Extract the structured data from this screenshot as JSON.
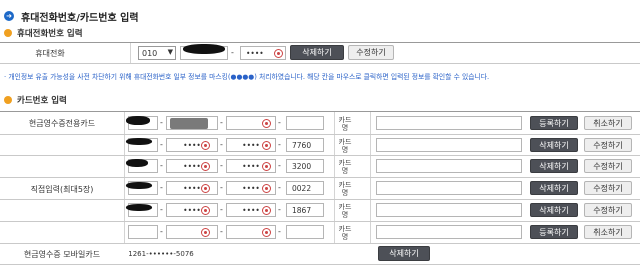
{
  "title": "휴대전화번호/카드번호 입력",
  "phone_section": {
    "heading": "휴대전화번호 입력",
    "row_label": "휴대전화",
    "prefix_selected": "010",
    "last_part": "••••",
    "delete_label": "삭제하기",
    "edit_label": "수정하기"
  },
  "notice": "· 개인정보 유출 가능성을 사전 차단하기 위해 휴대전화번호 일부 정보를 마스킹(●●●●) 처리하였습니다. 해당 칸을 마우스로 클릭하면 입력된 정보를 확인할 수 있습니다.",
  "card_section": {
    "heading": "카드번호 입력",
    "card_name_label_1": "카드",
    "card_name_label_2": "명",
    "cash_receipt_card": {
      "label": "현금영수증전용카드",
      "register_label": "등록하기",
      "cancel_label": "취소하기"
    },
    "direct_input": {
      "label": "직접입력(최대5장)",
      "rows": [
        {
          "part2": "••••",
          "part3": "••••",
          "last4": "7760",
          "delete_label": "삭제하기",
          "edit_label": "수정하기"
        },
        {
          "part2": "••••",
          "part3": "••••",
          "last4": "3200",
          "delete_label": "삭제하기",
          "edit_label": "수정하기"
        },
        {
          "part2": "••••",
          "part3": "••••",
          "last4": "0022",
          "delete_label": "삭제하기",
          "edit_label": "수정하기"
        },
        {
          "part2": "••••",
          "part3": "••••",
          "last4": "1867",
          "delete_label": "삭제하기",
          "edit_label": "수정하기"
        }
      ],
      "empty_row": {
        "register_label": "등록하기",
        "cancel_label": "취소하기"
      }
    },
    "mobile_card": {
      "label": "현금영수증 모바일카드",
      "number": "1261-••••••-5076",
      "delete_label": "삭제하기"
    }
  },
  "colors": {
    "accent_blue": "#1d69c8",
    "section_orange": "#f0a020",
    "dark_button": "#4d5057",
    "mask_eye": "#cc4444"
  }
}
